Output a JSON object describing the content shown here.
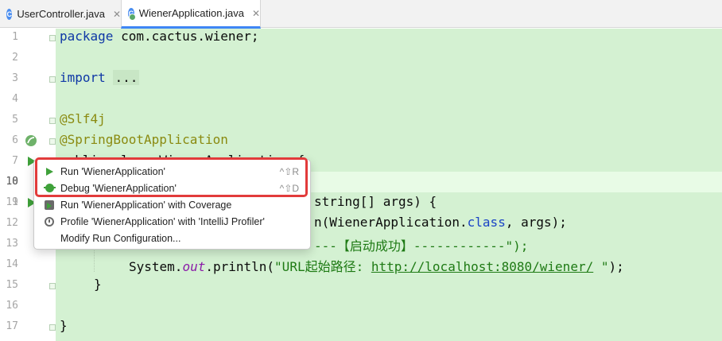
{
  "tabs": [
    {
      "label": "UserController.java",
      "icon": "java-class-icon"
    },
    {
      "label": "WienerApplication.java",
      "icon": "spring-boot-class-icon",
      "active": true
    }
  ],
  "tab_close_glyph": "✕",
  "line_numbers": [
    "1",
    "2",
    "3",
    "4",
    "5",
    "6",
    "7",
    "8",
    "9",
    "10",
    "11",
    "12",
    "13",
    "14",
    "15",
    "16",
    "17"
  ],
  "code": {
    "l1_kw": "package",
    "l1_rest": " com.cactus.wiener;",
    "l3_kw": "import",
    "l3_fold": "...",
    "l7": "@Slf4j",
    "l8": "@SpringBootApplication",
    "l9": "public class WienerApplication {",
    "l11": "string[] args) {",
    "l12_a": "n(WienerApplication.",
    "l12_cls": "class",
    "l12_b": ", args);",
    "l13": "---【启动成功】------------\");",
    "l14_a": "System.",
    "l14_fld": "out",
    "l14_b": ".println(",
    "l14_str": "\"URL起始路径: ",
    "l14_link": "http://localhost:8080/wiener/",
    "l14_str2": " \"",
    "l14_c": ");",
    "l15": "}",
    "l17": "}"
  },
  "menu": {
    "items": [
      {
        "label": "Run 'WienerApplication'",
        "shortcut": "^⇧R",
        "icon": "run-icon"
      },
      {
        "label": "Debug 'WienerApplication'",
        "shortcut": "^⇧D",
        "icon": "debug-icon"
      },
      {
        "label": "Run 'WienerApplication' with Coverage",
        "shortcut": "",
        "icon": "coverage-icon"
      },
      {
        "label": "Profile 'WienerApplication' with 'IntelliJ Profiler'",
        "shortcut": "",
        "icon": "profiler-icon"
      },
      {
        "label": "Modify Run Configuration...",
        "shortcut": "",
        "icon": ""
      }
    ]
  },
  "colors": {
    "code_background": "#d4f1d2",
    "highlight_border": "#e23b3b",
    "run_green": "#3fa13a",
    "active_tab_underline": "#3f86f5"
  }
}
